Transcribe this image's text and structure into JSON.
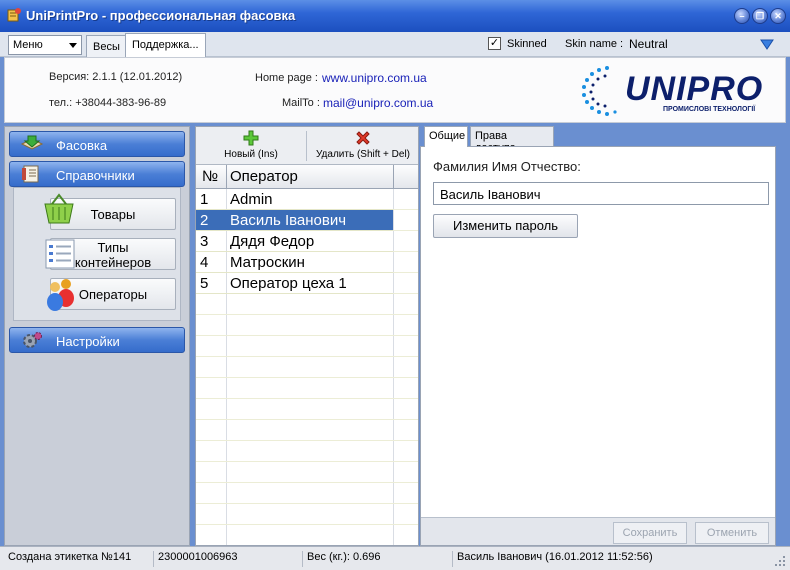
{
  "window": {
    "title": "UniPrintPro - профессиональная фасовка",
    "controls": [
      "minimize-icon",
      "restore-icon",
      "close-icon"
    ]
  },
  "toolbar": {
    "menu_label": "Меню",
    "tabs": [
      "Весы",
      "Поддержка..."
    ],
    "skinned_label": "Skinned",
    "skinned_checked": true,
    "skin_name_label": "Skin name :",
    "skin_name_value": "Neutral"
  },
  "header": {
    "version": "Версия: 2.1.1  (12.01.2012)",
    "phone": "тел.: +38044-383-96-89",
    "homepage_label": "Home page :",
    "homepage_url": "www.unipro.com.ua",
    "mailto_label": "MailTo :",
    "mailto_url": "mail@unipro.com.ua",
    "logo_text": "UNIPRO",
    "logo_subtext": "ПРОМИСЛОВІ ТЕХНОЛОГІЇ"
  },
  "nav": {
    "fasovka": "Фасовка",
    "spravochniki": "Справочники",
    "nastroiki": "Настройки",
    "sub": {
      "tovary": "Товары",
      "tipy_line1": "Типы",
      "tipy_line2": "контейнеров",
      "operatory": "Операторы"
    }
  },
  "operators": {
    "new_label": "Новый (Ins)",
    "delete_label": "Удалить (Shift + Del)",
    "col_num": "№",
    "col_name": "Оператор",
    "rows": [
      {
        "n": "1",
        "name": "Admin"
      },
      {
        "n": "2",
        "name": "Василь Іванович"
      },
      {
        "n": "3",
        "name": "Дядя Федор"
      },
      {
        "n": "4",
        "name": "Матроскин"
      },
      {
        "n": "5",
        "name": "Оператор цеха 1"
      }
    ],
    "selected_index": 1
  },
  "details": {
    "tab_general": "Общие",
    "tab_access": "Права доступа",
    "fio_label": "Фамилия Имя Отчество:",
    "fio_value": "Василь Іванович",
    "change_password": "Изменить пароль",
    "save": "Сохранить",
    "cancel": "Отменить"
  },
  "status": {
    "label_created": "Создана этикетка №141",
    "barcode": "2300001006963",
    "weight": "Вес (кг.): 0.696",
    "user": "Василь Іванович (16.01.2012 11:52:56)"
  },
  "colors": {
    "titlebar": "#2f66d6",
    "nav_button": "#4b7fd6",
    "selected_row": "#3b6db8",
    "link": "#1a22b8"
  }
}
